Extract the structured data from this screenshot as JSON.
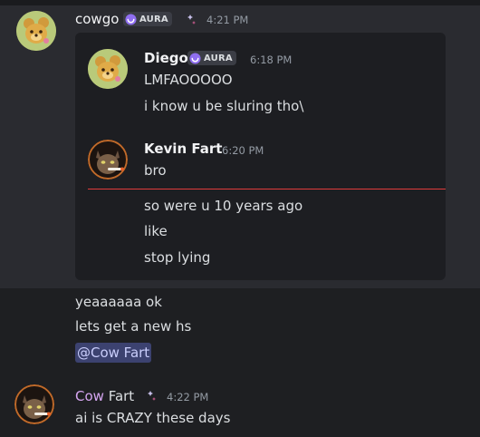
{
  "top_message": {
    "author": "cowgo",
    "badge": "AURA",
    "author_icon": "sparkle-icon",
    "timestamp": "4:21 PM",
    "lines": [
      "yeaaaaaa ok",
      "lets get a new hs"
    ],
    "mention": "@Cow Fart"
  },
  "forwarded": {
    "msg1": {
      "author": "Diego",
      "badge": "AURA",
      "timestamp": "6:18 PM",
      "lines": [
        "LMFAOOOOO",
        "i know u be sluring tho\\"
      ]
    },
    "msg2": {
      "author": "Kevin Fart",
      "timestamp": "6:20 PM",
      "lines": [
        "bro",
        "so were u 10 years ago",
        "like",
        "stop lying"
      ]
    }
  },
  "bottom_message": {
    "author_part1": "Cow",
    "author_part2": " Fart",
    "author_icon": "sparkle-icon",
    "timestamp": "4:22 PM",
    "lines": [
      "ai is CRAZY these days"
    ]
  },
  "colors": {
    "background": "#1e1f22",
    "highlight": "#2a2b30",
    "card": "#1d1e22",
    "new_divider": "#e03b3b",
    "mention_bg": "#3c4270",
    "cow_fart_name": "#d6a6f2"
  }
}
